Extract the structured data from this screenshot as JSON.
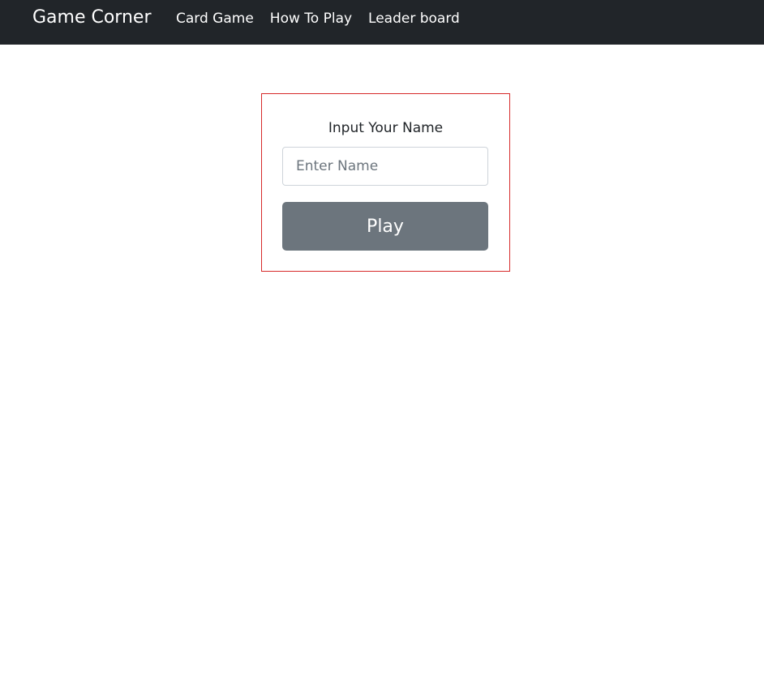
{
  "navbar": {
    "brand": "Game Corner",
    "links": [
      {
        "label": "Card Game"
      },
      {
        "label": "How To Play"
      },
      {
        "label": "Leader board"
      }
    ]
  },
  "form": {
    "label": "Input Your Name",
    "name_input": {
      "value": "",
      "placeholder": "Enter Name"
    },
    "play_label": "Play"
  },
  "colors": {
    "navbar_bg": "#212529",
    "form_border": "#d72a2a",
    "button_bg": "#6c757d"
  }
}
